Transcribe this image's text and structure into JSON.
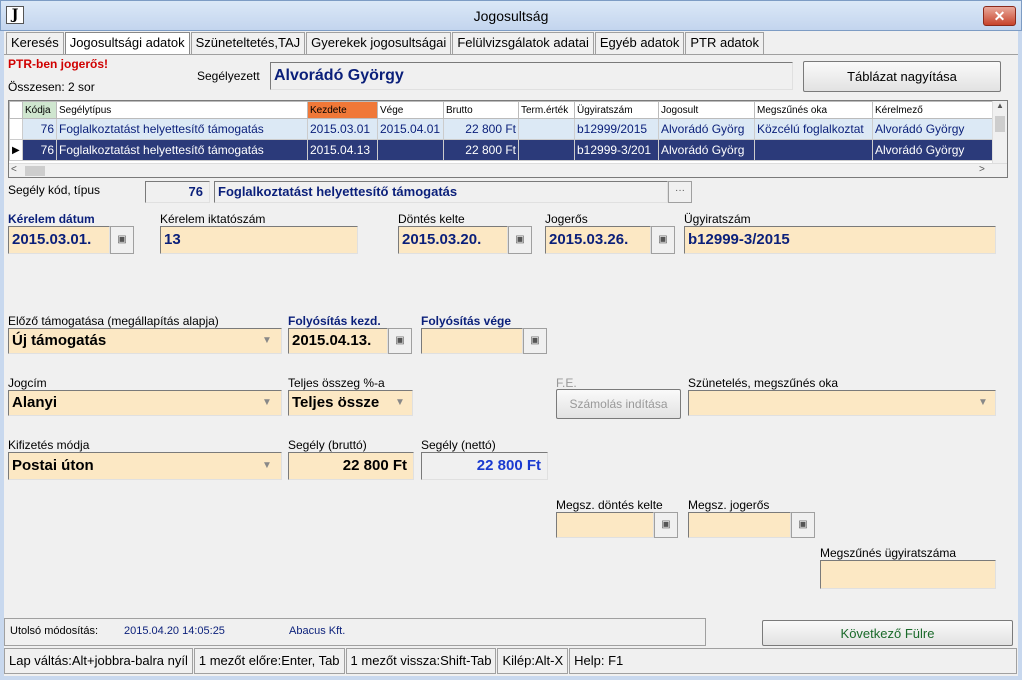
{
  "window": {
    "icon_letter": "J",
    "title": "Jogosultság",
    "close": "✕"
  },
  "tabs": [
    "Keresés",
    "Jogosultsági adatok",
    "Szüneteltetés,TAJ",
    "Gyerekek jogosultságai",
    "Felülvizsgálatok adatai",
    "Egyéb adatok",
    "PTR adatok"
  ],
  "active_tab": 1,
  "header": {
    "warning": "PTR-ben jogerős!",
    "count": "Összesen: 2 sor",
    "applicant_label": "Segélyezett",
    "applicant_name": "Alvorádó György",
    "enlarge_button": "Táblázat nagyítása"
  },
  "grid": {
    "columns": [
      "Kódja",
      "Segélytípus",
      "Kezdete",
      "Vége",
      "Brutto",
      "Term.érték",
      "Ügyiratszám",
      "Jogosult",
      "Megszűnés oka",
      "Kérelmező"
    ],
    "rows": [
      [
        "76",
        "Foglalkoztatást helyettesítő támogatás",
        "2015.03.01",
        "2015.04.01",
        "22 800 Ft",
        "",
        "b12999/2015",
        "Alvorádó Györg",
        "Közcélú foglalkoztat",
        "Alvorádó György"
      ],
      [
        "76",
        "Foglalkoztatást helyettesítő támogatás",
        "2015.04.13",
        "",
        "22 800 Ft",
        "",
        "b12999-3/201",
        "Alvorádó Györg",
        "",
        "Alvorádó György"
      ]
    ],
    "selected_row": 1
  },
  "form": {
    "segely_kod_label": "Segély kód, típus",
    "segely_kod": "76",
    "segely_tipus": "Foglalkoztatást helyettesítő támogatás",
    "ellipsis": "···",
    "kerelem_datum_label": "Kérelem dátum",
    "kerelem_datum": "2015.03.01.",
    "kerelem_iktatoszam_label": "Kérelem iktatószám",
    "kerelem_iktatoszam": "13",
    "dontes_kelte_label": "Döntés kelte",
    "dontes_kelte": "2015.03.20.",
    "jogeros_label": "Jogerős",
    "jogeros": "2015.03.26.",
    "ugyiratszam_label": "Ügyiratszám",
    "ugyiratszam": "b12999-3/2015",
    "elozo_label": "Előző támogatása (megállapítás alapja)",
    "elozo": "Új támogatás",
    "foly_kezd_label": "Folyósítás kezd.",
    "foly_kezd": "2015.04.13.",
    "foly_vege_label": "Folyósítás vége",
    "foly_vege": "",
    "jogcim_label": "Jogcím",
    "jogcim": "Alanyi",
    "teljes_label": "Teljes összeg %-a",
    "teljes": "Teljes össze",
    "fe_label": "F.E.",
    "szamolas_button": "Számolás indítása",
    "szunetelés_label": "Szünetelés, megszűnés oka",
    "kifizetes_label": "Kifizetés módja",
    "kifizetes": "Postai úton",
    "brutto_label": "Segély (bruttó)",
    "brutto": "22 800 Ft",
    "netto_label": "Segély (nettó)",
    "netto": "22 800 Ft",
    "megsz_dontes_label": "Megsz. döntés kelte",
    "megsz_jogeros_label": "Megsz. jogerős",
    "megsz_ugyirat_label": "Megszűnés ügyiratszáma"
  },
  "footer": {
    "last_mod_label": "Utolsó módosítás:",
    "last_mod_time": "2015.04.20 14:05:25",
    "last_mod_by": "Abacus Kft.",
    "next_button": "Következő Fülre"
  },
  "statusbar": [
    "Lap váltás:Alt+jobbra-balra nyíl",
    "1 mezőt előre:Enter, Tab",
    "1 mezőt vissza:Shift-Tab",
    "Kilép:Alt-X",
    "Help: F1"
  ]
}
